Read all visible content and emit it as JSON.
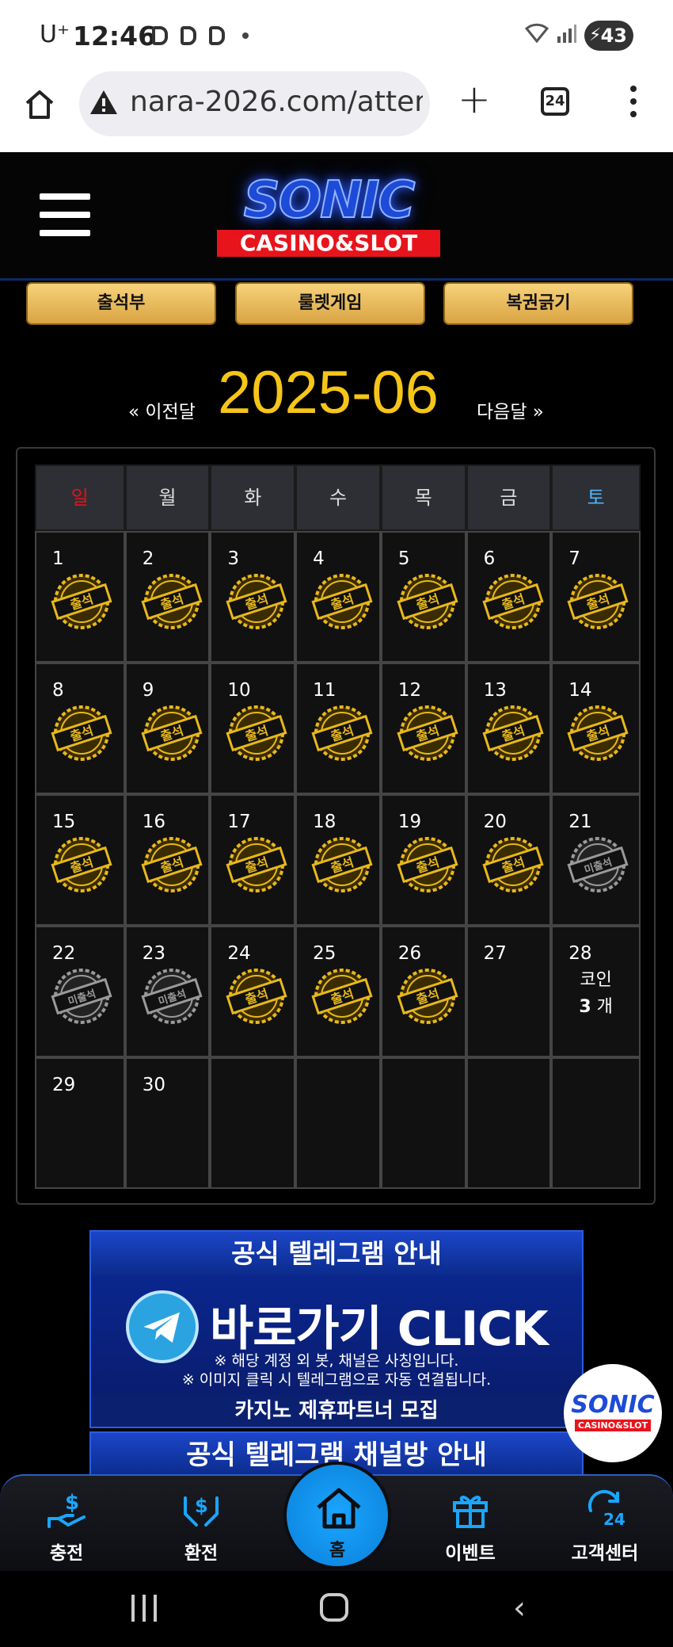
{
  "status_bar": {
    "carrier": "U⁺",
    "time": "12:46",
    "battery": "43"
  },
  "browser": {
    "url": "nara-2026.com/attendance",
    "tab_count": "24"
  },
  "site": {
    "logo_main": "SONIC",
    "logo_sub": "CASINO&SLOT"
  },
  "top_buttons": [
    "출석부",
    "룰렛게임",
    "복권긁기"
  ],
  "calendar": {
    "prev_label": "« 이전달",
    "month": "2025-06",
    "next_label": "다음달 »",
    "weekdays": [
      "일",
      "월",
      "화",
      "수",
      "목",
      "금",
      "토"
    ],
    "weekday_colors": {
      "sun": "#e0141c",
      "sat": "#4fb6ff"
    },
    "stamp_attended": "출석",
    "stamp_absent": "미출석",
    "weeks": [
      [
        {
          "day": "1",
          "status": "attended"
        },
        {
          "day": "2",
          "status": "attended"
        },
        {
          "day": "3",
          "status": "attended"
        },
        {
          "day": "4",
          "status": "attended"
        },
        {
          "day": "5",
          "status": "attended"
        },
        {
          "day": "6",
          "status": "attended"
        },
        {
          "day": "7",
          "status": "attended"
        }
      ],
      [
        {
          "day": "8",
          "status": "attended"
        },
        {
          "day": "9",
          "status": "attended"
        },
        {
          "day": "10",
          "status": "attended"
        },
        {
          "day": "11",
          "status": "attended"
        },
        {
          "day": "12",
          "status": "attended"
        },
        {
          "day": "13",
          "status": "attended"
        },
        {
          "day": "14",
          "status": "attended"
        }
      ],
      [
        {
          "day": "15",
          "status": "attended"
        },
        {
          "day": "16",
          "status": "attended"
        },
        {
          "day": "17",
          "status": "attended"
        },
        {
          "day": "18",
          "status": "attended"
        },
        {
          "day": "19",
          "status": "attended"
        },
        {
          "day": "20",
          "status": "attended"
        },
        {
          "day": "21",
          "status": "absent"
        }
      ],
      [
        {
          "day": "22",
          "status": "absent"
        },
        {
          "day": "23",
          "status": "absent"
        },
        {
          "day": "24",
          "status": "attended"
        },
        {
          "day": "25",
          "status": "attended"
        },
        {
          "day": "26",
          "status": "attended"
        },
        {
          "day": "27",
          "status": "none"
        },
        {
          "day": "28",
          "status": "today",
          "coin_label": "코인",
          "coin_count": "3",
          "coin_unit": "개"
        }
      ],
      [
        {
          "day": "29",
          "status": "none"
        },
        {
          "day": "30",
          "status": "none"
        },
        {
          "day": "",
          "status": "none"
        },
        {
          "day": "",
          "status": "none"
        },
        {
          "day": "",
          "status": "none"
        },
        {
          "day": "",
          "status": "none"
        },
        {
          "day": "",
          "status": "none"
        }
      ]
    ]
  },
  "banner": {
    "title": "공식 텔레그램 안내",
    "cta": "바로가기 CLICK",
    "note1": "※ 해당 계정 외 봇, 채널은 사칭입니다.",
    "note2": "※ 이미지 클릭 시 텔레그램으로 자동 연결됩니다.",
    "partner": "카지노 제휴파트너 모집",
    "title2": "공식 텔레그램 채널방 안내"
  },
  "float_logo": {
    "main": "SONIC",
    "sub": "CASINO&SLOT"
  },
  "bottom_nav": {
    "charge": "충전",
    "exchange": "환전",
    "home": "홈",
    "event": "이벤트",
    "support": "고객센터"
  },
  "colors": {
    "gold": "#f5c518",
    "accent_blue": "#1aa6ff",
    "button_gold": "#e7b95a"
  }
}
